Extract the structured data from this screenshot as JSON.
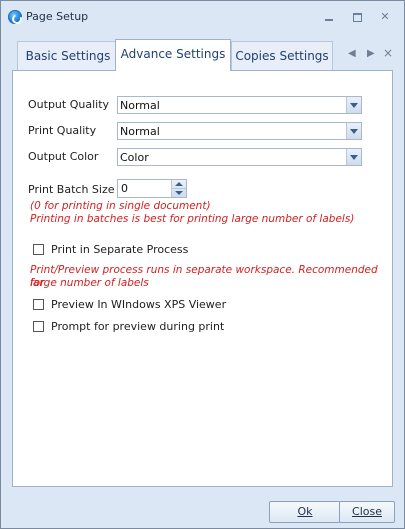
{
  "window": {
    "title": "Page Setup"
  },
  "tabs": [
    {
      "label": "Basic Settings"
    },
    {
      "label": "Advance Settings"
    },
    {
      "label": "Copies Settings"
    }
  ],
  "tab_nav": {
    "left": "◀",
    "right": "▶",
    "close": "×"
  },
  "settings": {
    "output_quality": {
      "label": "Output Quality",
      "value": "Normal"
    },
    "print_quality": {
      "label": "Print Quality",
      "value": "Normal"
    },
    "output_color": {
      "label": "Output Color",
      "value": "Color"
    },
    "print_batch_size": {
      "label": "Print Batch Size",
      "value": "0"
    }
  },
  "notes": {
    "batch_line1": "(0 for printing in single document)",
    "batch_line2": "Printing in batches is best for printing large number of labels)",
    "process_line1": "Print/Preview process runs in separate workspace. Recommended for",
    "process_line2": "large number of labels"
  },
  "checkboxes": [
    {
      "label": "Print in Separate Process",
      "checked": false
    },
    {
      "label": "Preview In WIndows XPS Viewer",
      "checked": false
    },
    {
      "label": "Prompt for preview during print",
      "checked": false
    }
  ],
  "buttons": {
    "ok": "Ok",
    "close": "Close"
  },
  "colors": {
    "note_red": "#d42020",
    "frame_bg": "#dce7f5",
    "tab_text": "#1f4170"
  }
}
